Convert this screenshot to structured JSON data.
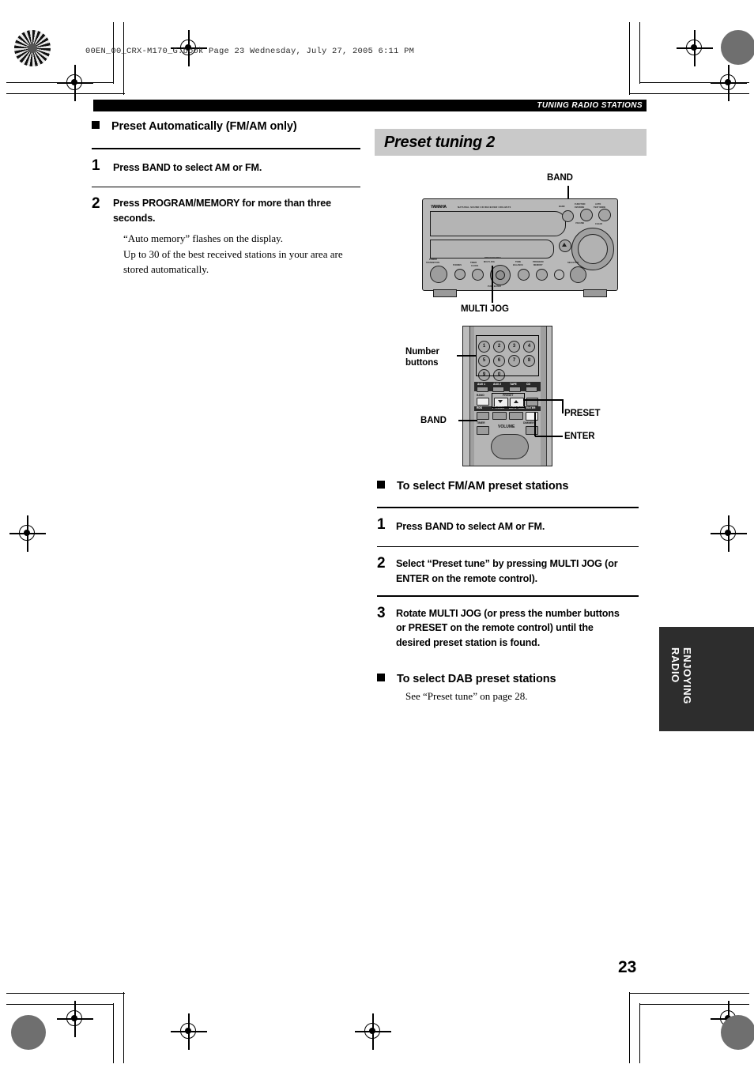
{
  "page": {
    "file_header": "00EN_00_CRX-M170_G.book  Page 23  Wednesday, July 27, 2005  6:11 PM",
    "running_head": "TUNING RADIO STATIONS",
    "page_number": "23",
    "side_tab": "ENJOYING\nRADIO",
    "accent_gray": "#c9c9c9",
    "tab_color": "#2d2d2d"
  },
  "left_column": {
    "section_heading": "Preset Automatically (FM/AM only)",
    "steps": [
      {
        "num": "1",
        "text": "Press BAND to select AM or FM.",
        "notes": []
      },
      {
        "num": "2",
        "text": "Press PROGRAM/MEMORY for more than three seconds.",
        "notes": [
          "“Auto memory” flashes on the display.",
          "Up to 30 of the best received stations in your area are stored automatically."
        ]
      }
    ]
  },
  "right_column": {
    "banner_title": "Preset tuning 2",
    "unit_callouts": {
      "band": "BAND",
      "multi_jog": "MULTI JOG"
    },
    "remote_callouts": {
      "number_buttons": "Number\nbuttons",
      "band": "BAND",
      "preset": "PRESET",
      "enter": "ENTER"
    },
    "section_fm_am": {
      "heading": "To select FM/AM preset stations",
      "steps": [
        {
          "num": "1",
          "text": "Press BAND to select AM or FM."
        },
        {
          "num": "2",
          "text": "Select “Preset tune” by pressing MULTI JOG (or ENTER on the remote control)."
        },
        {
          "num": "3",
          "text": "Rotate MULTI JOG (or press the number buttons or PRESET on the remote control) until the desired preset station is found."
        }
      ]
    },
    "section_dab": {
      "heading": "To select DAB preset stations",
      "note": "See “Preset tune” on page 28."
    }
  },
  "artwork": {
    "unit_brand": "YAMAHA",
    "unit_model_line": "NATURAL SOUND CD RECEIVER   CRX-M170",
    "unit_panel_labels": [
      "POWER",
      "STANDBY/ON",
      "PHONES",
      "TIMER",
      "MULTI JOG",
      "PRESET/TUNING",
      "TONE",
      "BALANCE",
      "PROGRAM",
      "MEMORY",
      "VOLUME",
      "BAND",
      "FUNCTION",
      "CLEAR"
    ],
    "remote_number_keys": [
      "1",
      "2",
      "3",
      "4",
      "5",
      "6",
      "7",
      "8",
      "9",
      "0"
    ],
    "remote_source_keys": [
      "AUX 1",
      "AUX 2",
      "TAPE",
      "CD"
    ],
    "remote_row_band": [
      "BAND",
      "PRESET"
    ],
    "remote_row_mid": [
      "RDS",
      "PTY/EON",
      "AUTO TUNE",
      "ENTER"
    ],
    "remote_row_bottom": [
      "TIMER",
      "VOLUME",
      "DIMMER"
    ],
    "preset_arrows": [
      "⌄",
      "⌃"
    ]
  }
}
